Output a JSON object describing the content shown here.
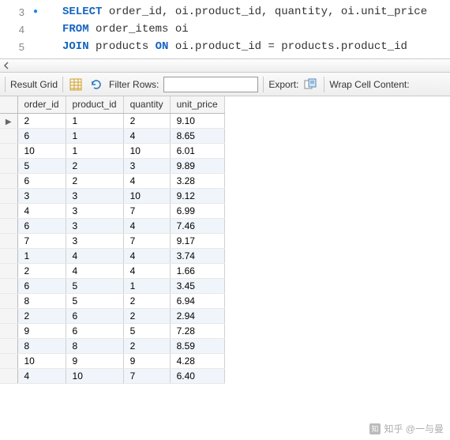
{
  "editor": {
    "lines": [
      {
        "num": "3",
        "marker": "●",
        "tokens": [
          {
            "t": "SELECT",
            "c": "kw"
          },
          {
            "t": " order_id, oi.product_id, quantity, oi.unit_price",
            "c": "tok"
          }
        ]
      },
      {
        "num": "4",
        "marker": "",
        "tokens": [
          {
            "t": "FROM",
            "c": "kw"
          },
          {
            "t": " order_items oi",
            "c": "tok"
          }
        ]
      },
      {
        "num": "5",
        "marker": "",
        "tokens": [
          {
            "t": "JOIN",
            "c": "kw"
          },
          {
            "t": " products ",
            "c": "tok"
          },
          {
            "t": "ON",
            "c": "kw"
          },
          {
            "t": " oi.product_id = products.product_id",
            "c": "tok"
          }
        ]
      }
    ]
  },
  "toolbar": {
    "result_grid": "Result Grid",
    "filter_label": "Filter Rows:",
    "filter_value": "",
    "export_label": "Export:",
    "wrap_label": "Wrap Cell Content:"
  },
  "grid": {
    "columns": [
      "order_id",
      "product_id",
      "quantity",
      "unit_price"
    ],
    "rows": [
      {
        "order_id": "2",
        "product_id": "1",
        "quantity": "2",
        "unit_price": "9.10"
      },
      {
        "order_id": "6",
        "product_id": "1",
        "quantity": "4",
        "unit_price": "8.65"
      },
      {
        "order_id": "10",
        "product_id": "1",
        "quantity": "10",
        "unit_price": "6.01"
      },
      {
        "order_id": "5",
        "product_id": "2",
        "quantity": "3",
        "unit_price": "9.89"
      },
      {
        "order_id": "6",
        "product_id": "2",
        "quantity": "4",
        "unit_price": "3.28"
      },
      {
        "order_id": "3",
        "product_id": "3",
        "quantity": "10",
        "unit_price": "9.12"
      },
      {
        "order_id": "4",
        "product_id": "3",
        "quantity": "7",
        "unit_price": "6.99"
      },
      {
        "order_id": "6",
        "product_id": "3",
        "quantity": "4",
        "unit_price": "7.46"
      },
      {
        "order_id": "7",
        "product_id": "3",
        "quantity": "7",
        "unit_price": "9.17"
      },
      {
        "order_id": "1",
        "product_id": "4",
        "quantity": "4",
        "unit_price": "3.74"
      },
      {
        "order_id": "2",
        "product_id": "4",
        "quantity": "4",
        "unit_price": "1.66"
      },
      {
        "order_id": "6",
        "product_id": "5",
        "quantity": "1",
        "unit_price": "3.45"
      },
      {
        "order_id": "8",
        "product_id": "5",
        "quantity": "2",
        "unit_price": "6.94"
      },
      {
        "order_id": "2",
        "product_id": "6",
        "quantity": "2",
        "unit_price": "2.94"
      },
      {
        "order_id": "9",
        "product_id": "6",
        "quantity": "5",
        "unit_price": "7.28"
      },
      {
        "order_id": "8",
        "product_id": "8",
        "quantity": "2",
        "unit_price": "8.59"
      },
      {
        "order_id": "10",
        "product_id": "9",
        "quantity": "9",
        "unit_price": "4.28"
      },
      {
        "order_id": "4",
        "product_id": "10",
        "quantity": "7",
        "unit_price": "6.40"
      }
    ]
  },
  "watermark": "知乎 @一与曼"
}
